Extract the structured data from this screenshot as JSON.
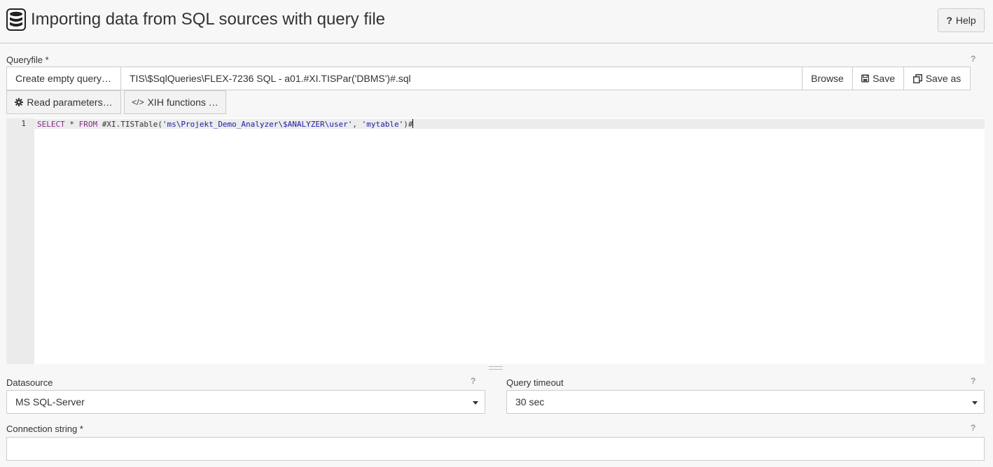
{
  "header": {
    "title": "Importing data from SQL sources with query file",
    "help_label": "Help",
    "help_icon": "question-icon"
  },
  "queryfile": {
    "label": "Queryfile *",
    "help": "?",
    "create_label": "Create empty query…",
    "path_value": "TIS\\$SqlQueries\\FLEX-7236 SQL - a01.#XI.TISPar('DBMS')#.sql",
    "browse_label": "Browse",
    "save_label": "Save",
    "save_as_label": "Save as",
    "read_params_label": "Read parameters…",
    "xih_label": "XIH functions …"
  },
  "editor": {
    "line_numbers": [
      "1"
    ],
    "code": {
      "kw1": "SELECT",
      "t1": " * ",
      "kw2": "FROM",
      "t2": " #XI.TISTable(",
      "s1": "'ms\\Projekt_Demo_Analyzer\\$ANALYZER\\user'",
      "t3": ", ",
      "s2": "'mytable'",
      "t4": ")#"
    }
  },
  "datasource": {
    "label": "Datasource",
    "help": "?",
    "value": "MS SQL-Server"
  },
  "timeout": {
    "label": "Query timeout",
    "help": "?",
    "value": "30 sec"
  },
  "connection": {
    "label": "Connection string *",
    "help": "?",
    "value": ""
  },
  "colors": {
    "keyword": "#8a2a8a",
    "string": "#1a1aa6",
    "gutter": "#ebebeb",
    "background": "#f7f7f8"
  }
}
